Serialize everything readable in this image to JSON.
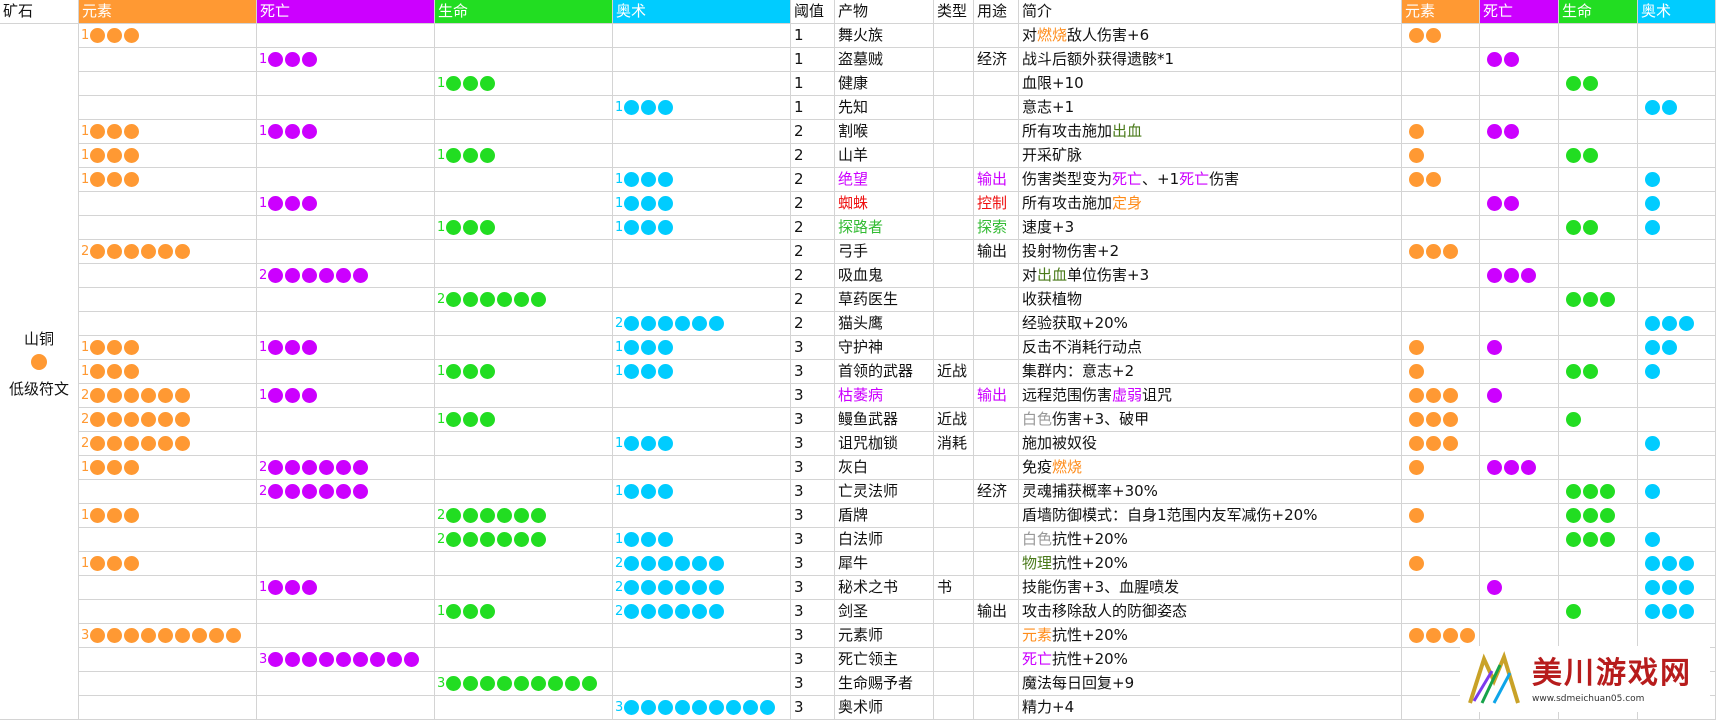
{
  "colors": {
    "element": "#ff9933",
    "death": "#cc00ff",
    "life": "#22dd22",
    "arcane": "#00ccff",
    "red": "#ee1111",
    "orange": "#ff8c1a",
    "green": "#33bb33",
    "grey": "#999999",
    "darkgreen": "#4a7a1a"
  },
  "left": {
    "header": "矿石",
    "ore_name": "山铜",
    "ore_grade": "低级符文"
  },
  "headers": {
    "element": "元素",
    "death": "死亡",
    "life": "生命",
    "arcane": "奥术",
    "threshold": "阈值",
    "product": "产物",
    "type": "类型",
    "use": "用途",
    "desc": "简介",
    "c_element": "元素",
    "c_death": "死亡",
    "c_life": "生命",
    "c_arcane": "奥术"
  },
  "rows": [
    {
      "req": {
        "element": 1
      },
      "t": "1",
      "product": "舞火族",
      "pc": "",
      "type": "",
      "use": "",
      "uc": "",
      "desc": [
        {
          "s": "对"
        },
        {
          "s": "燃烧",
          "c": "orange"
        },
        {
          "s": "敌人伤害+6"
        }
      ],
      "cost": {
        "element": 2
      }
    },
    {
      "req": {
        "death": 1
      },
      "t": "1",
      "product": "盗墓贼",
      "pc": "",
      "type": "",
      "use": "经济",
      "uc": "",
      "desc": [
        {
          "s": "战斗后额外获得遗骸*1"
        }
      ],
      "cost": {
        "death": 2
      }
    },
    {
      "req": {
        "life": 1
      },
      "t": "1",
      "product": "健康",
      "pc": "",
      "type": "",
      "use": "",
      "uc": "",
      "desc": [
        {
          "s": "血限+10"
        }
      ],
      "cost": {
        "life": 2
      }
    },
    {
      "req": {
        "arcane": 1
      },
      "t": "1",
      "product": "先知",
      "pc": "",
      "type": "",
      "use": "",
      "uc": "",
      "desc": [
        {
          "s": "意志+1"
        }
      ],
      "cost": {
        "arcane": 2
      }
    },
    {
      "req": {
        "element": 1,
        "death": 1
      },
      "t": "2",
      "product": "割喉",
      "pc": "",
      "type": "",
      "use": "",
      "uc": "",
      "desc": [
        {
          "s": "所有攻击施加"
        },
        {
          "s": "出血",
          "c": "darkgreen"
        }
      ],
      "cost": {
        "element": 1,
        "death": 2
      }
    },
    {
      "req": {
        "element": 1,
        "life": 1
      },
      "t": "2",
      "product": "山羊",
      "pc": "",
      "type": "",
      "use": "",
      "uc": "",
      "desc": [
        {
          "s": "开采矿脉"
        }
      ],
      "cost": {
        "element": 1,
        "life": 2
      }
    },
    {
      "req": {
        "element": 1,
        "arcane": 1
      },
      "t": "2",
      "product": "绝望",
      "pc": "death",
      "type": "",
      "use": "输出",
      "uc": "death",
      "desc": [
        {
          "s": "伤害类型变为"
        },
        {
          "s": "死亡",
          "c": "death"
        },
        {
          "s": "、+1"
        },
        {
          "s": "死亡",
          "c": "death"
        },
        {
          "s": "伤害"
        }
      ],
      "cost": {
        "element": 2,
        "arcane": 1
      }
    },
    {
      "req": {
        "death": 1,
        "arcane": 1
      },
      "t": "2",
      "product": "蜘蛛",
      "pc": "red",
      "type": "",
      "use": "控制",
      "uc": "red",
      "desc": [
        {
          "s": "所有攻击施加"
        },
        {
          "s": "定身",
          "c": "orange"
        }
      ],
      "cost": {
        "death": 2,
        "arcane": 1
      }
    },
    {
      "req": {
        "life": 1,
        "arcane": 1
      },
      "t": "2",
      "product": "探路者",
      "pc": "green",
      "type": "",
      "use": "探索",
      "uc": "green",
      "desc": [
        {
          "s": "速度+3"
        }
      ],
      "cost": {
        "life": 2,
        "arcane": 1
      }
    },
    {
      "req": {
        "element": 2
      },
      "t": "2",
      "product": "弓手",
      "pc": "",
      "type": "",
      "use": "输出",
      "uc": "",
      "desc": [
        {
          "s": "投射物伤害+2"
        }
      ],
      "cost": {
        "element": 3
      }
    },
    {
      "req": {
        "death": 2
      },
      "t": "2",
      "product": "吸血鬼",
      "pc": "",
      "type": "",
      "use": "",
      "uc": "",
      "desc": [
        {
          "s": "对"
        },
        {
          "s": "出血",
          "c": "darkgreen"
        },
        {
          "s": "单位伤害+3"
        }
      ],
      "cost": {
        "death": 3
      }
    },
    {
      "req": {
        "life": 2
      },
      "t": "2",
      "product": "草药医生",
      "pc": "",
      "type": "",
      "use": "",
      "uc": "",
      "desc": [
        {
          "s": "收获植物"
        }
      ],
      "cost": {
        "life": 3
      }
    },
    {
      "req": {
        "arcane": 2
      },
      "t": "2",
      "product": "猫头鹰",
      "pc": "",
      "type": "",
      "use": "",
      "uc": "",
      "desc": [
        {
          "s": "经验获取+20%"
        }
      ],
      "cost": {
        "arcane": 3
      }
    },
    {
      "req": {
        "element": 1,
        "death": 1,
        "arcane": 1
      },
      "t": "3",
      "product": "守护神",
      "pc": "",
      "type": "",
      "use": "",
      "uc": "",
      "desc": [
        {
          "s": "反击不消耗行动点"
        }
      ],
      "cost": {
        "element": 1,
        "death": 1,
        "arcane": 2
      }
    },
    {
      "req": {
        "element": 1,
        "life": 1,
        "arcane": 1
      },
      "t": "3",
      "product": "首领的武器",
      "pc": "",
      "type": "近战",
      "use": "",
      "uc": "",
      "desc": [
        {
          "s": "集群内：意志+2"
        }
      ],
      "cost": {
        "element": 1,
        "life": 2,
        "arcane": 1
      }
    },
    {
      "req": {
        "element": 2,
        "death": 1
      },
      "t": "3",
      "product": "枯萎病",
      "pc": "death",
      "type": "",
      "use": "输出",
      "uc": "death",
      "desc": [
        {
          "s": "远程范围伤害"
        },
        {
          "s": "虚弱",
          "c": "death"
        },
        {
          "s": "诅咒"
        }
      ],
      "cost": {
        "element": 3,
        "death": 1
      }
    },
    {
      "req": {
        "element": 2,
        "life": 1
      },
      "t": "3",
      "product": "鳗鱼武器",
      "pc": "",
      "type": "近战",
      "use": "",
      "uc": "",
      "desc": [
        {
          "s": "白色",
          "c": "grey"
        },
        {
          "s": "伤害+3、破甲"
        }
      ],
      "cost": {
        "element": 3,
        "life": 1
      }
    },
    {
      "req": {
        "element": 2,
        "arcane": 1
      },
      "t": "3",
      "product": "诅咒枷锁",
      "pc": "",
      "type": "消耗",
      "use": "",
      "uc": "",
      "desc": [
        {
          "s": "施加被奴役"
        }
      ],
      "cost": {
        "element": 3,
        "arcane": 1
      }
    },
    {
      "req": {
        "element": 1,
        "death": 2
      },
      "t": "3",
      "product": "灰白",
      "pc": "",
      "type": "",
      "use": "",
      "uc": "",
      "desc": [
        {
          "s": "免疫"
        },
        {
          "s": "燃烧",
          "c": "orange"
        }
      ],
      "cost": {
        "element": 1,
        "death": 3
      }
    },
    {
      "req": {
        "death": 2,
        "arcane": 1
      },
      "t": "3",
      "product": "亡灵法师",
      "pc": "",
      "type": "",
      "use": "经济",
      "uc": "",
      "desc": [
        {
          "s": "灵魂捕获概率+30%"
        }
      ],
      "cost": {
        "life": 3,
        "arcane": 1
      }
    },
    {
      "req": {
        "element": 1,
        "life": 2
      },
      "t": "3",
      "product": "盾牌",
      "pc": "",
      "type": "",
      "use": "",
      "uc": "",
      "desc": [
        {
          "s": "盾墙防御模式：自身1范围内友军减伤+20%"
        }
      ],
      "cost": {
        "element": 1,
        "life": 3
      }
    },
    {
      "req": {
        "life": 2,
        "arcane": 1
      },
      "t": "3",
      "product": "白法师",
      "pc": "",
      "type": "",
      "use": "",
      "uc": "",
      "desc": [
        {
          "s": "白色",
          "c": "grey"
        },
        {
          "s": "抗性+20%"
        }
      ],
      "cost": {
        "life": 3,
        "arcane": 1
      }
    },
    {
      "req": {
        "element": 1,
        "arcane": 2
      },
      "t": "3",
      "product": "犀牛",
      "pc": "",
      "type": "",
      "use": "",
      "uc": "",
      "desc": [
        {
          "s": "物理",
          "c": "darkgreen"
        },
        {
          "s": "抗性+20%"
        }
      ],
      "cost": {
        "element": 1,
        "arcane": 3
      }
    },
    {
      "req": {
        "death": 1,
        "arcane": 2
      },
      "t": "3",
      "product": "秘术之书",
      "pc": "",
      "type": "书",
      "use": "",
      "uc": "",
      "desc": [
        {
          "s": "技能伤害+3、血腥喷发"
        }
      ],
      "cost": {
        "death": 1,
        "arcane": 3
      }
    },
    {
      "req": {
        "life": 1,
        "arcane": 2
      },
      "t": "3",
      "product": "剑圣",
      "pc": "",
      "type": "",
      "use": "输出",
      "uc": "",
      "desc": [
        {
          "s": "攻击移除敌人的防御姿态"
        }
      ],
      "cost": {
        "life": 1,
        "arcane": 3
      }
    },
    {
      "req": {
        "element": 3
      },
      "t": "3",
      "product": "元素师",
      "pc": "",
      "type": "",
      "use": "",
      "uc": "",
      "desc": [
        {
          "s": "元素",
          "c": "orange"
        },
        {
          "s": "抗性+20%"
        }
      ],
      "cost": {
        "element": 4
      }
    },
    {
      "req": {
        "death": 3
      },
      "t": "3",
      "product": "死亡领主",
      "pc": "",
      "type": "",
      "use": "",
      "uc": "",
      "desc": [
        {
          "s": "死亡",
          "c": "death"
        },
        {
          "s": "抗性+20%"
        }
      ],
      "cost": {}
    },
    {
      "req": {
        "life": 3
      },
      "t": "3",
      "product": "生命赐予者",
      "pc": "",
      "type": "",
      "use": "",
      "uc": "",
      "desc": [
        {
          "s": "魔法每日回复+9"
        }
      ],
      "cost": {}
    },
    {
      "req": {
        "arcane": 3
      },
      "t": "3",
      "product": "奥术师",
      "pc": "",
      "type": "",
      "use": "",
      "uc": "",
      "desc": [
        {
          "s": "精力+4"
        }
      ],
      "cost": {}
    }
  ],
  "watermark": {
    "title": "美川游戏网",
    "url": "www.sdmeichuan05.com"
  }
}
